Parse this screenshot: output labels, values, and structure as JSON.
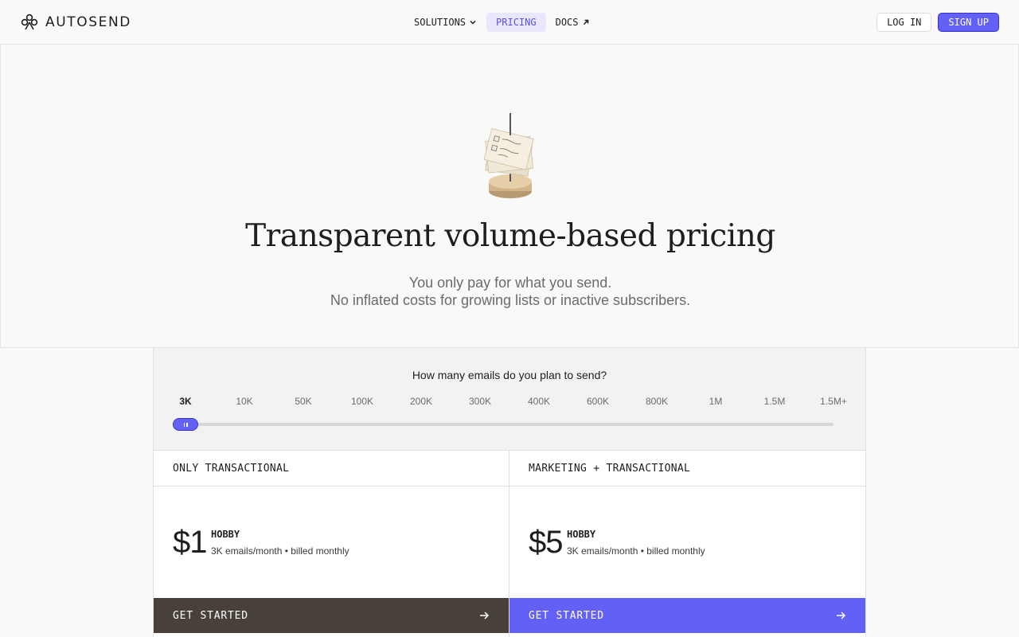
{
  "brand": {
    "name": "AUTOSEND"
  },
  "nav": {
    "links": [
      {
        "label": "SOLUTIONS",
        "icon": "chevron-down-icon"
      },
      {
        "label": "PRICING",
        "active": true
      },
      {
        "label": "DOCS",
        "icon": "arrow-up-right-icon"
      }
    ],
    "login": "LOG IN",
    "signup": "SIGN UP"
  },
  "hero": {
    "title": "Transparent volume-based pricing",
    "subtitle_line1": "You only pay for what you send.",
    "subtitle_line2": "No inflated costs for growing lists or inactive subscribers."
  },
  "slider": {
    "question": "How many emails do you plan to send?",
    "ticks": [
      "3K",
      "10K",
      "50K",
      "100K",
      "200K",
      "300K",
      "400K",
      "600K",
      "800K",
      "1M",
      "1.5M",
      "1.5M+"
    ],
    "selected_index": 0
  },
  "plans": [
    {
      "header": "ONLY TRANSACTIONAL",
      "price": "$1",
      "tier": "HOBBY",
      "desc": "3K emails/month • billed monthly",
      "cta": "GET STARTED"
    },
    {
      "header": "MARKETING + TRANSACTIONAL",
      "price": "$5",
      "tier": "HOBBY",
      "desc": "3K emails/month • billed monthly",
      "cta": "GET STARTED"
    }
  ],
  "colors": {
    "accent": "#6360f5",
    "dark_cta": "#47413a",
    "background": "#f9f9f9"
  }
}
